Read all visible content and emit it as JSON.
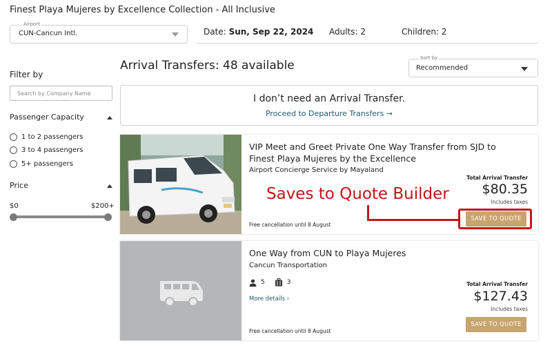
{
  "header": {
    "hotel_title": "Finest Playa Mujeres by Excellence Collection - All Inclusive",
    "airport": {
      "label": "Airport",
      "value": "CUN-Cancun Intl."
    },
    "date_label": "Date:",
    "date_value": "Sun, Sep 22, 2024",
    "adults": "Adults: 2",
    "children": "Children: 2"
  },
  "filters": {
    "heading": "Filter by",
    "company_search_placeholder": "Search by Company Name",
    "capacity_title": "Passenger Capacity",
    "capacity_options": [
      "1 to 2 passengers",
      "3 to 4 passengers",
      "5+ passengers"
    ],
    "price_title": "Price",
    "price_min": "$0",
    "price_max": "$200+"
  },
  "results": {
    "title": "Arrival Transfers:",
    "count": "48 available",
    "sort": {
      "label": "Sort by",
      "value": "Recommended"
    }
  },
  "no_transfer": {
    "heading": "I don’t need an Arrival Transfer.",
    "link": "Proceed to Departure Transfers →"
  },
  "cards": [
    {
      "title": "VIP Meet and Greet Private One Way Transfer from SJD to Finest Playa Mujeres by the Excellence",
      "provider": "Airport Concierge Service by Mayaland",
      "cancellation": "Free cancellation until 8 August",
      "price_label": "Total Arrival Transfer",
      "price": "$80.35",
      "taxes": "Includes taxes",
      "button": "SAVE TO QUOTE"
    },
    {
      "title": "One Way from CUN to Playa Mujeres",
      "provider": "Cancun Transportation",
      "passengers": "5",
      "luggage": "3",
      "more_details": "More details ›",
      "cancellation": "Free cancellation until 8 August",
      "price_label": "Total Arrival Transfer",
      "price": "$127.43",
      "taxes": "Includes taxes",
      "button": "SAVE TO QUOTE"
    }
  ],
  "annotation": {
    "text": "Saves to Quote Builder",
    "color": "#c0161b"
  },
  "colors": {
    "accent_button": "#c8a46e",
    "link": "#1e5a6e"
  }
}
